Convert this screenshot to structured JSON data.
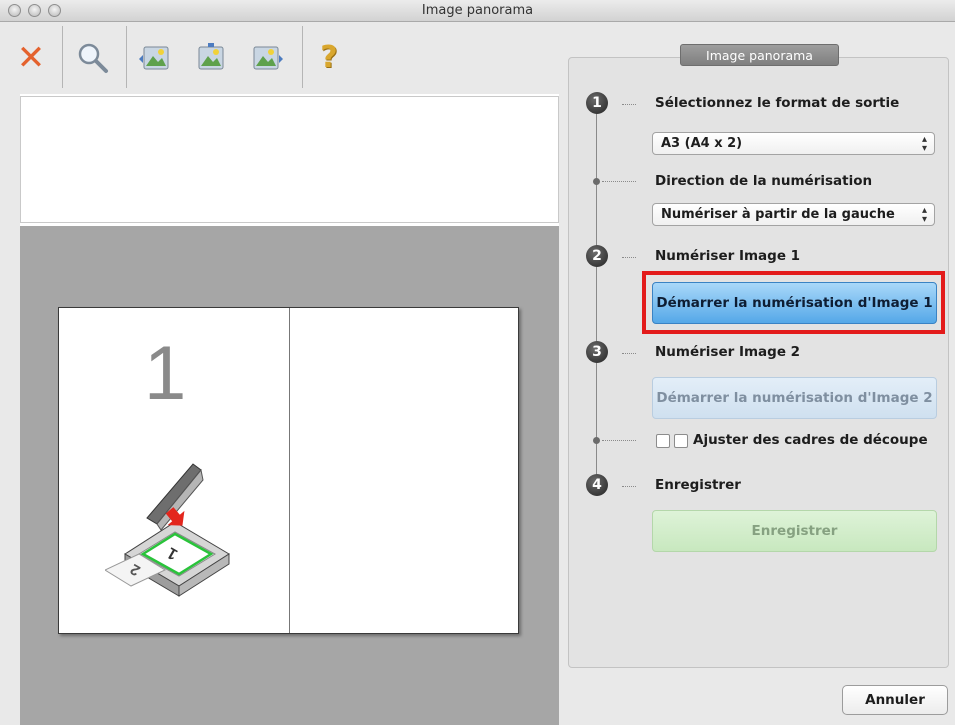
{
  "window": {
    "title": "Image panorama"
  },
  "toolbar": {
    "icons": [
      "close-icon",
      "zoom-icon",
      "panorama-left-icon",
      "panorama-center-icon",
      "panorama-right-icon",
      "help-icon"
    ],
    "help_glyph": "?"
  },
  "preview": {
    "page_number": "1"
  },
  "panel": {
    "tab_title": "Image panorama",
    "steps": [
      {
        "number": "1",
        "label": "Sélectionnez le format de sortie"
      },
      {
        "number": "2",
        "label": "Numériser Image 1"
      },
      {
        "number": "3",
        "label": "Numériser Image 2"
      },
      {
        "number": "4",
        "label": "Enregistrer"
      }
    ],
    "output_format": {
      "value": "A3 (A4 x 2)"
    },
    "direction": {
      "label": "Direction de la numérisation",
      "value": "Numériser à partir de la gauche"
    },
    "start_scan_1_label": "Démarrer la numérisation d'Image 1",
    "start_scan_2_label": "Démarrer la numérisation d'Image 2",
    "crop_frames_label": "Ajuster des cadres de découpe",
    "save_label": "Enregistrer"
  },
  "footer": {
    "cancel_label": "Annuler"
  },
  "colors": {
    "highlight": "#e31b1b",
    "primary_button": "#55a8e8",
    "save_button_disabled": "#c8e8bf",
    "close_icon": "#e4622e"
  }
}
